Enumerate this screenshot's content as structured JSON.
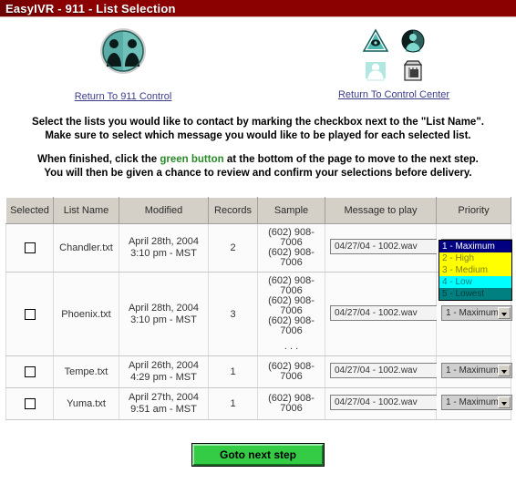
{
  "window": {
    "title": "EasyIVR - 911 - List Selection",
    "title_bg": "#8b0000",
    "title_fg": "#ffffff"
  },
  "nav": {
    "left": {
      "icon": "two-people-circle-icon",
      "link_label": "Return To 911 Control"
    },
    "right": {
      "icons": [
        "warning-triangle-icon",
        "person-circle-icon",
        "person-silhouette-icon",
        "trash-can-icon"
      ],
      "link_label": "Return To Control Center"
    }
  },
  "instructions": {
    "line1": "Select the lists you would like to contact by marking the checkbox next to the \"List Name\".",
    "line2": "Make sure to select which message you would like to be played for each selected list.",
    "line3_pre": "When finished, click the ",
    "line3_green": "green button",
    "line3_post": " at the bottom of the page to move to the next step.",
    "line4": "You will then be given a chance to review and confirm your selections before delivery.",
    "green_color": "#2a8a2a"
  },
  "table": {
    "headers": [
      "Selected",
      "List Name",
      "Modified",
      "Records",
      "Sample",
      "Message to play",
      "Priority"
    ],
    "rows": [
      {
        "selected": false,
        "name": "Chandler.txt",
        "modified_date": "April 28th, 2004",
        "modified_time": "3:10 pm - MST",
        "records": "2",
        "samples": [
          "(602) 908-7006",
          "(602) 908-7006"
        ],
        "more": "",
        "message": "04/27/04 - 1002.wav",
        "priority": "1 - Maximum",
        "priority_open": true
      },
      {
        "selected": false,
        "name": "Phoenix.txt",
        "modified_date": "April 28th, 2004",
        "modified_time": "3:10 pm - MST",
        "records": "3",
        "samples": [
          "(602) 908-7006",
          "(602) 908-7006",
          "(602) 908-7006"
        ],
        "more": ". . .",
        "message": "04/27/04 - 1002.wav",
        "priority": "1 - Maximum",
        "priority_open": false
      },
      {
        "selected": false,
        "name": "Tempe.txt",
        "modified_date": "April 26th, 2004",
        "modified_time": "4:29 pm - MST",
        "records": "1",
        "samples": [
          "(602) 908-7006"
        ],
        "more": "",
        "message": "04/27/04 - 1002.wav",
        "priority": "1 - Maximum",
        "priority_open": false
      },
      {
        "selected": false,
        "name": "Yuma.txt",
        "modified_date": "April 27th, 2004",
        "modified_time": "9:51 am - MST",
        "records": "1",
        "samples": [
          "(602) 908-7006"
        ],
        "more": "",
        "message": "04/27/04 - 1002.wav",
        "priority": "1 - Maximum",
        "priority_open": false
      }
    ]
  },
  "priority_options": [
    {
      "label": "1 - Maximum",
      "bg": "#000080",
      "fg": "#ffffff"
    },
    {
      "label": "2 - High",
      "bg": "#ffff00",
      "fg": "#808000"
    },
    {
      "label": "3 - Medium",
      "bg": "#ffff00",
      "fg": "#808000"
    },
    {
      "label": "4 - Low",
      "bg": "#00ffff",
      "fg": "#008080"
    },
    {
      "label": "5 - Lowest",
      "bg": "#008080",
      "fg": "#004040"
    }
  ],
  "footer": {
    "submit_label": "Goto next step",
    "submit_color": "#33cc44"
  }
}
